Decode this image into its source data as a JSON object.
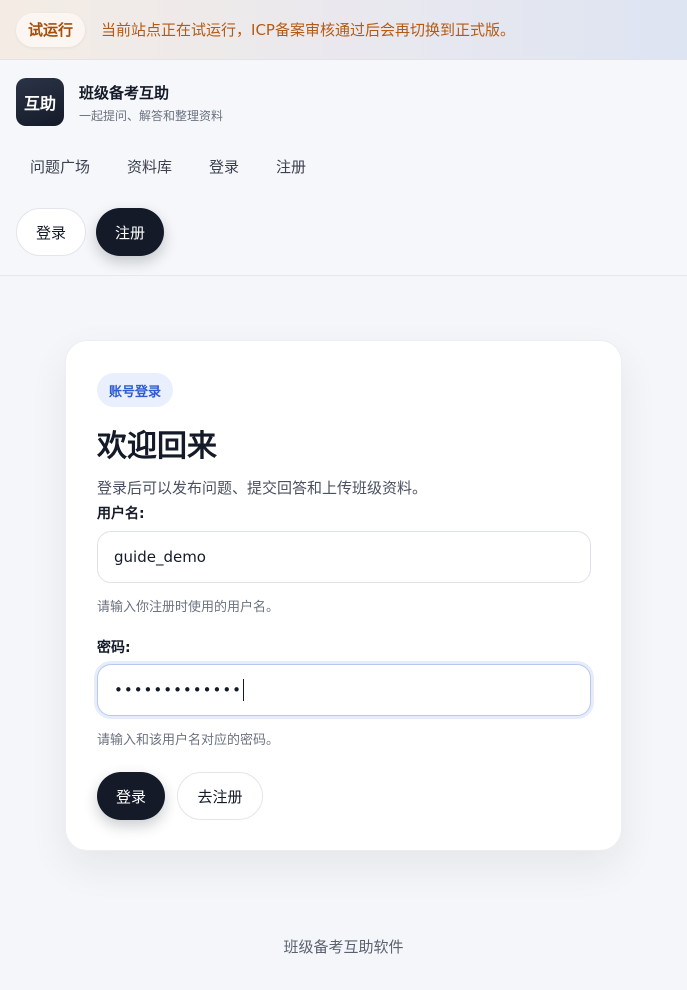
{
  "banner": {
    "tag": "试运行",
    "text": "当前站点正在试运行，ICP备案审核通过后会再切换到正式版。"
  },
  "brand": {
    "logo_text": "互助",
    "name": "班级备考互助",
    "subtitle": "一起提问、解答和整理资料"
  },
  "nav": {
    "items": [
      {
        "label": "问题广场"
      },
      {
        "label": "资料库"
      },
      {
        "label": "登录"
      },
      {
        "label": "注册"
      }
    ]
  },
  "header_actions": {
    "login_label": "登录",
    "register_label": "注册"
  },
  "login_card": {
    "badge": "账号登录",
    "title": "欢迎回来",
    "description": "登录后可以发布问题、提交回答和上传班级资料。",
    "username": {
      "label": "用户名:",
      "value": "guide_demo",
      "hint": "请输入你注册时使用的用户名。"
    },
    "password": {
      "label": "密码:",
      "masked_value": "•••••••••••••",
      "hint": "请输入和该用户名对应的密码。"
    },
    "submit_label": "登录",
    "register_link_label": "去注册"
  },
  "footer": {
    "text": "班级备考互助软件"
  },
  "colors": {
    "primary_dark": "#141a28",
    "badge_blue": "#2f5bd3",
    "banner_orange": "#b45a14"
  }
}
